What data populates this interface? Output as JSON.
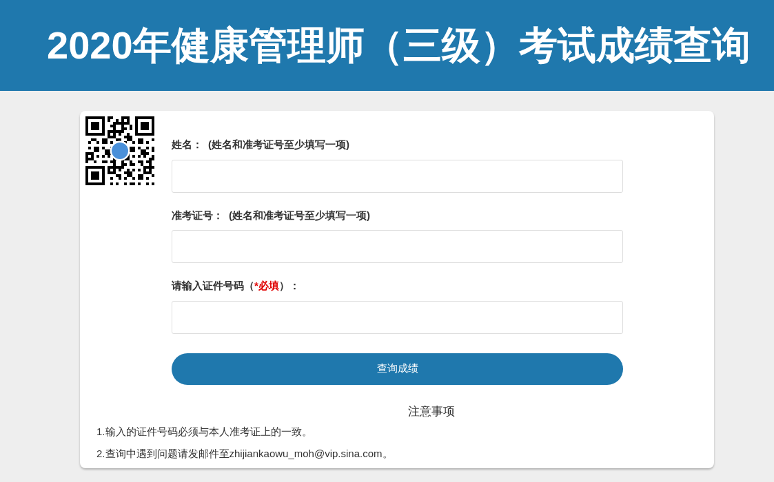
{
  "header": {
    "title": "2020年健康管理师（三级）考试成绩查询"
  },
  "fields": [
    {
      "label": "姓名：",
      "hint": "(姓名和准考证号至少填写一项)"
    },
    {
      "label": "准考证号：",
      "hint": "(姓名和准考证号至少填写一项)"
    },
    {
      "label": "请输入证件号码（",
      "required_mark": "*必填",
      "label_end": "）："
    }
  ],
  "submit": {
    "label": "查询成绩"
  },
  "notes": {
    "title": "注意事项",
    "items": [
      "1.输入的证件号码必须与本人准考证上的一致。",
      "2.查询中遇到问题请发邮件至zhijiankaowu_moh@vip.sina.com。"
    ]
  }
}
